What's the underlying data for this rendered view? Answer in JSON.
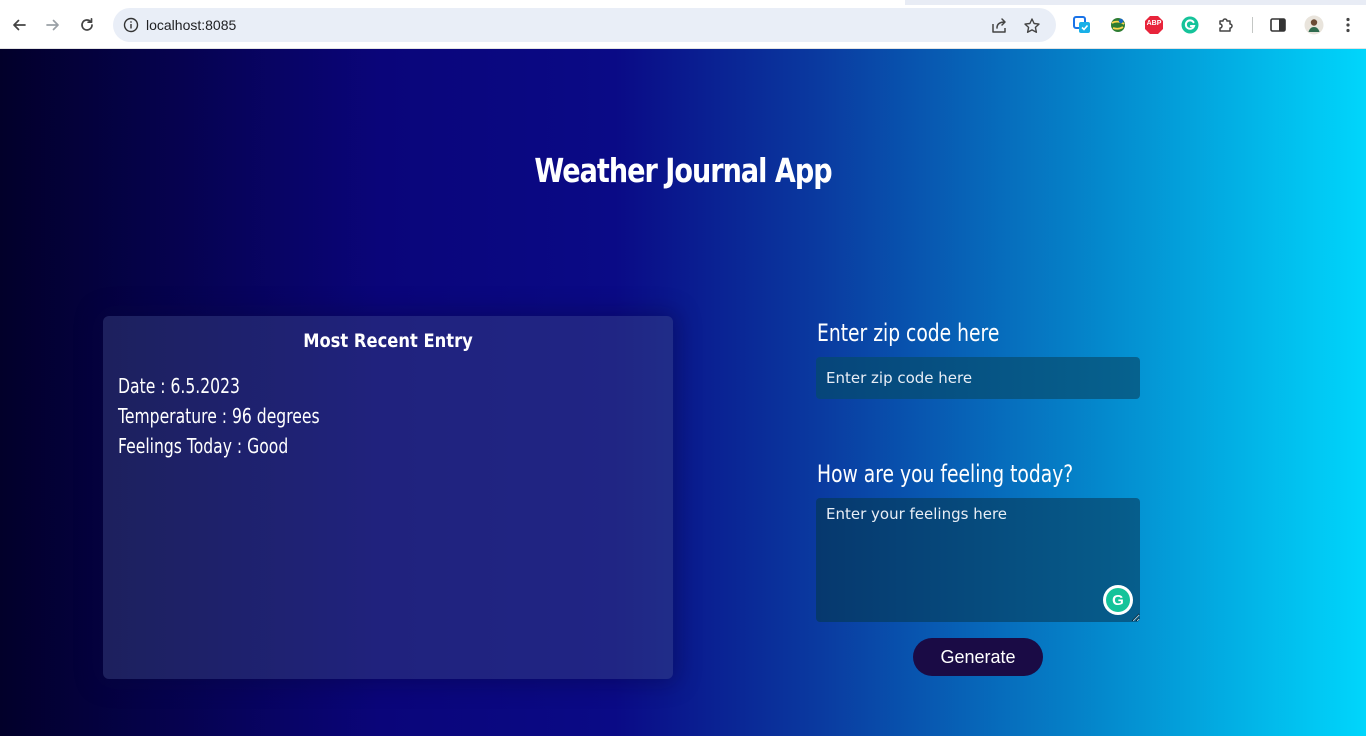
{
  "browser": {
    "url": "localhost:8085",
    "icons": {
      "back": "arrow-left-icon",
      "forward": "arrow-right-icon",
      "reload": "reload-icon",
      "info": "info-icon",
      "share": "share-icon",
      "bookmark": "star-icon",
      "extensions": [
        "screen-capture-extension",
        "globe-extension",
        "adblock-plus-extension",
        "grammarly-extension",
        "puzzle-extensions-icon"
      ],
      "side_panel": "side-panel-icon",
      "profile": "avatar",
      "menu": "kebab-menu-icon"
    },
    "adblock_label": "ABP"
  },
  "app": {
    "title": "Weather Journal App",
    "entry": {
      "heading": "Most Recent Entry",
      "date": "Date : 6.5.2023",
      "temperature": "Temperature : 96 degrees",
      "feelings": "Feelings Today : Good"
    },
    "form": {
      "zip_label": "Enter zip code here",
      "zip_placeholder": "Enter zip code here",
      "feelings_label": "How are you feeling today?",
      "feelings_placeholder": "Enter your feelings here",
      "generate_label": "Generate",
      "grammarly_glyph": "G"
    }
  },
  "colors": {
    "gradient_start": "#02002a",
    "gradient_mid": "#0a057a",
    "gradient_end": "#00d6fc",
    "button_bg": "#1a0b45",
    "grammarly": "#15c39a"
  }
}
